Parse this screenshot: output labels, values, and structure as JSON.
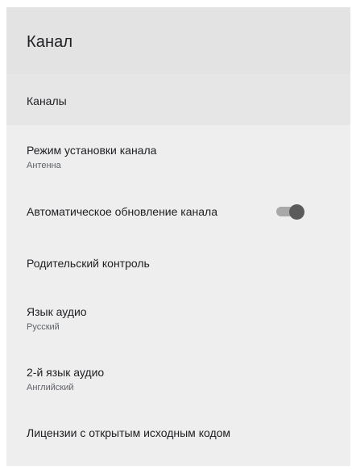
{
  "header": {
    "title": "Канал"
  },
  "items": [
    {
      "title": "Каналы"
    },
    {
      "title": "Режим установки канала",
      "subtitle": "Антенна"
    },
    {
      "title": "Автоматическое обновление канала",
      "toggle": "on"
    },
    {
      "title": "Родительский контроль"
    },
    {
      "title": "Язык аудио",
      "subtitle": "Русский"
    },
    {
      "title": "2-й язык аудио",
      "subtitle": "Английский"
    },
    {
      "title": "Лицензии с открытым исходным кодом"
    }
  ],
  "colors": {
    "panel_bg": "#eeeeee",
    "header_bg": "#e3e3e3",
    "toggle_knob": "#5b5b5b",
    "toggle_track": "#a8a8a8"
  }
}
